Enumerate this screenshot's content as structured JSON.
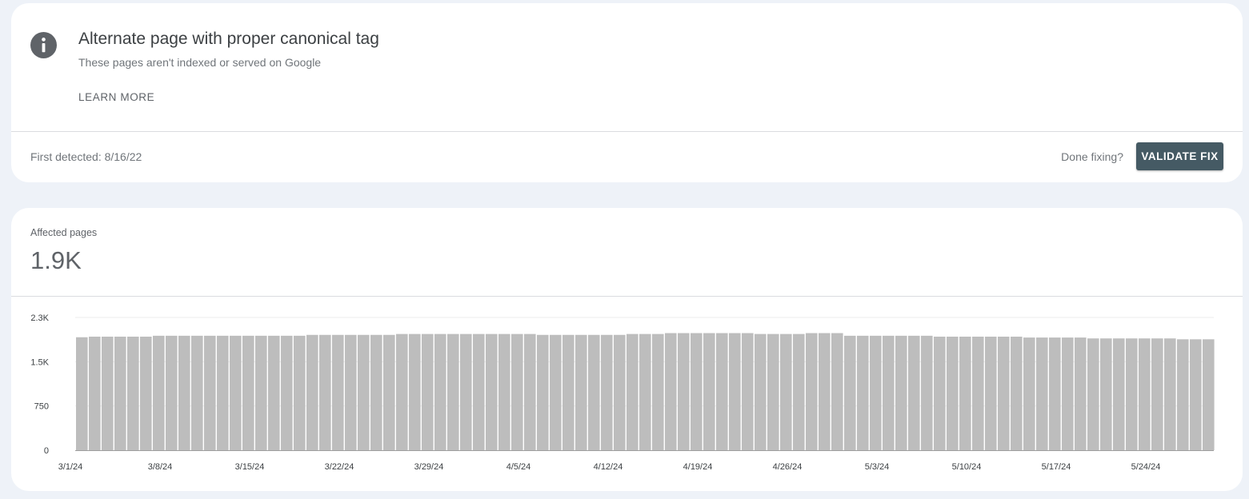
{
  "issue": {
    "title": "Alternate page with proper canonical tag",
    "subtitle": "These pages aren't indexed or served on Google",
    "learn_more": "LEARN MORE",
    "first_detected": "First detected: 8/16/22",
    "done_fixing": "Done fixing?",
    "validate_button": "VALIDATE FIX",
    "icon": "info-icon"
  },
  "metric": {
    "label": "Affected pages",
    "value": "1.9K"
  },
  "colors": {
    "bar": "#bdbdbd",
    "button": "#455a64",
    "background": "#eef2f8"
  },
  "chart_data": {
    "type": "bar",
    "ylim": [
      0,
      2250
    ],
    "y_ticks": [
      {
        "value": 0,
        "label": "0"
      },
      {
        "value": 750,
        "label": "750"
      },
      {
        "value": 1500,
        "label": "1.5K"
      },
      {
        "value": 2250,
        "label": "2.3K"
      }
    ],
    "x_tick_labels": [
      {
        "index": 0,
        "label": "3/1/24"
      },
      {
        "index": 7,
        "label": "3/8/24"
      },
      {
        "index": 14,
        "label": "3/15/24"
      },
      {
        "index": 21,
        "label": "3/22/24"
      },
      {
        "index": 28,
        "label": "3/29/24"
      },
      {
        "index": 35,
        "label": "4/5/24"
      },
      {
        "index": 42,
        "label": "4/12/24"
      },
      {
        "index": 49,
        "label": "4/19/24"
      },
      {
        "index": 56,
        "label": "4/26/24"
      },
      {
        "index": 63,
        "label": "5/3/24"
      },
      {
        "index": 70,
        "label": "5/10/24"
      },
      {
        "index": 77,
        "label": "5/17/24"
      },
      {
        "index": 84,
        "label": "5/24/24"
      }
    ],
    "grid": true,
    "legend": "none",
    "values": [
      1915,
      1925,
      1925,
      1925,
      1925,
      1925,
      1940,
      1940,
      1940,
      1940,
      1940,
      1940,
      1940,
      1940,
      1940,
      1940,
      1940,
      1940,
      1955,
      1955,
      1955,
      1955,
      1955,
      1955,
      1955,
      1970,
      1970,
      1970,
      1970,
      1970,
      1970,
      1970,
      1970,
      1970,
      1970,
      1970,
      1955,
      1955,
      1955,
      1955,
      1955,
      1955,
      1955,
      1970,
      1970,
      1970,
      1985,
      1985,
      1985,
      1985,
      1985,
      1985,
      1985,
      1970,
      1970,
      1970,
      1970,
      1985,
      1985,
      1985,
      1940,
      1940,
      1940,
      1940,
      1940,
      1940,
      1940,
      1925,
      1925,
      1925,
      1925,
      1925,
      1925,
      1925,
      1910,
      1910,
      1910,
      1910,
      1910,
      1895,
      1895,
      1895,
      1895,
      1895,
      1895,
      1895,
      1880,
      1880,
      1880
    ]
  }
}
